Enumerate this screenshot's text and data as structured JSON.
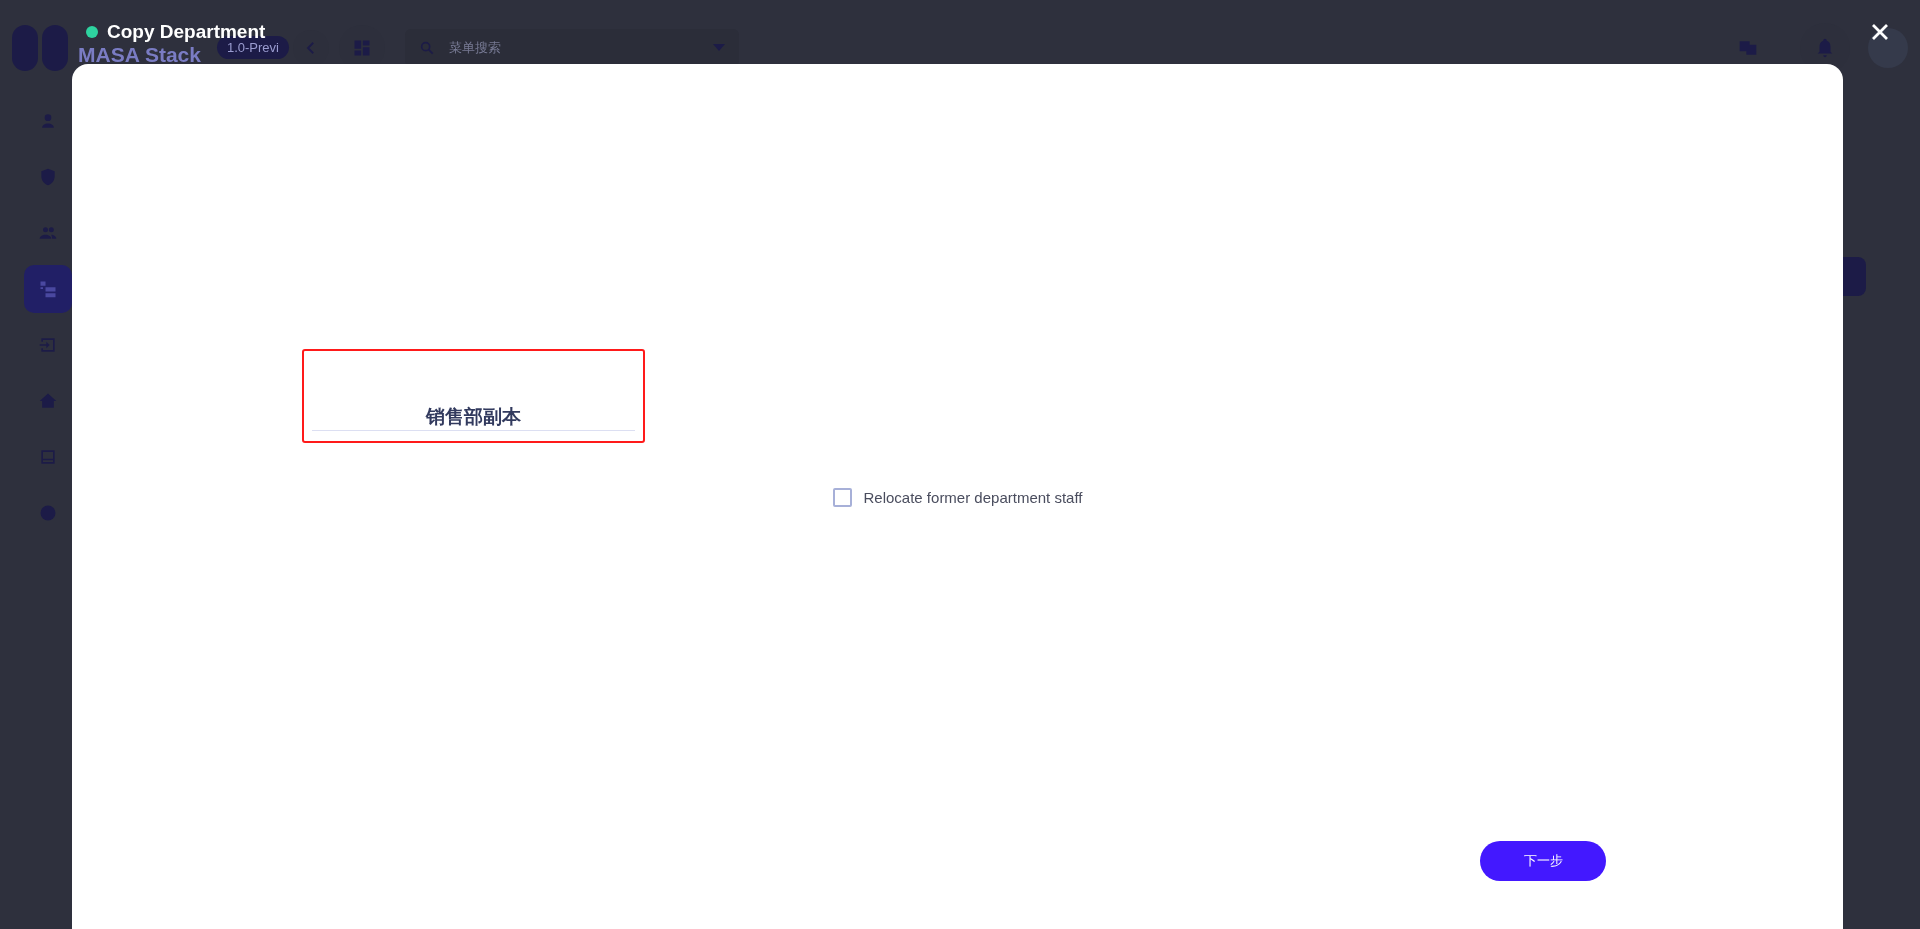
{
  "app": {
    "logo_title": "MASA Stack",
    "version_badge": "1.0-Previ",
    "search": {
      "placeholder": "菜单搜索"
    },
    "sidebar": {
      "items": [
        {
          "selected": false
        },
        {
          "selected": false
        },
        {
          "selected": false
        },
        {
          "selected": true
        },
        {
          "selected": false
        },
        {
          "selected": false
        },
        {
          "selected": false
        },
        {
          "selected": false
        }
      ]
    }
  },
  "dialog": {
    "title": "Copy Department",
    "name_field": {
      "value": "销售部副本",
      "error": true
    },
    "relocate_staff": {
      "label": "Relocate former department staff",
      "checked": false
    },
    "next_button": "下一步"
  }
}
